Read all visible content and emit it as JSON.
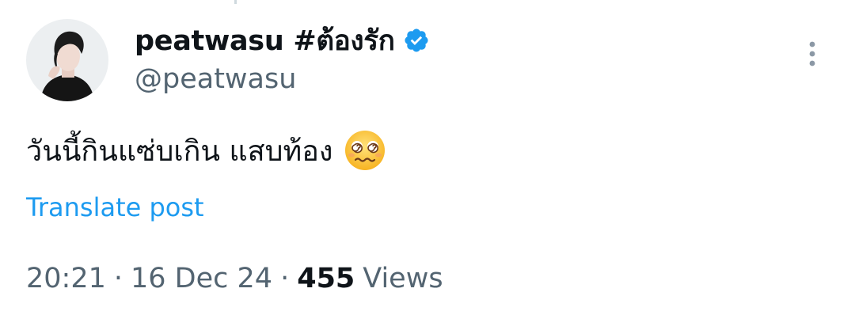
{
  "author": {
    "display_name": "peatwasu #ต้องรัก",
    "handle": "@peatwasu",
    "verified_icon": "verified-badge-icon",
    "verified_color": "#1d9bf0"
  },
  "post": {
    "text": "วันนี้กินแซ่บเกิน แสบท้อง",
    "emoji": "🥴",
    "emoji_icon": "dizzy-woozy-face-icon",
    "translate_label": "Translate post"
  },
  "meta": {
    "time": "20:21",
    "separator": "·",
    "date": "16 Dec 24",
    "views_count": "455",
    "views_label": "Views"
  },
  "colors": {
    "text_primary": "#0f1419",
    "text_secondary": "#536471",
    "accent": "#1d9bf0"
  }
}
